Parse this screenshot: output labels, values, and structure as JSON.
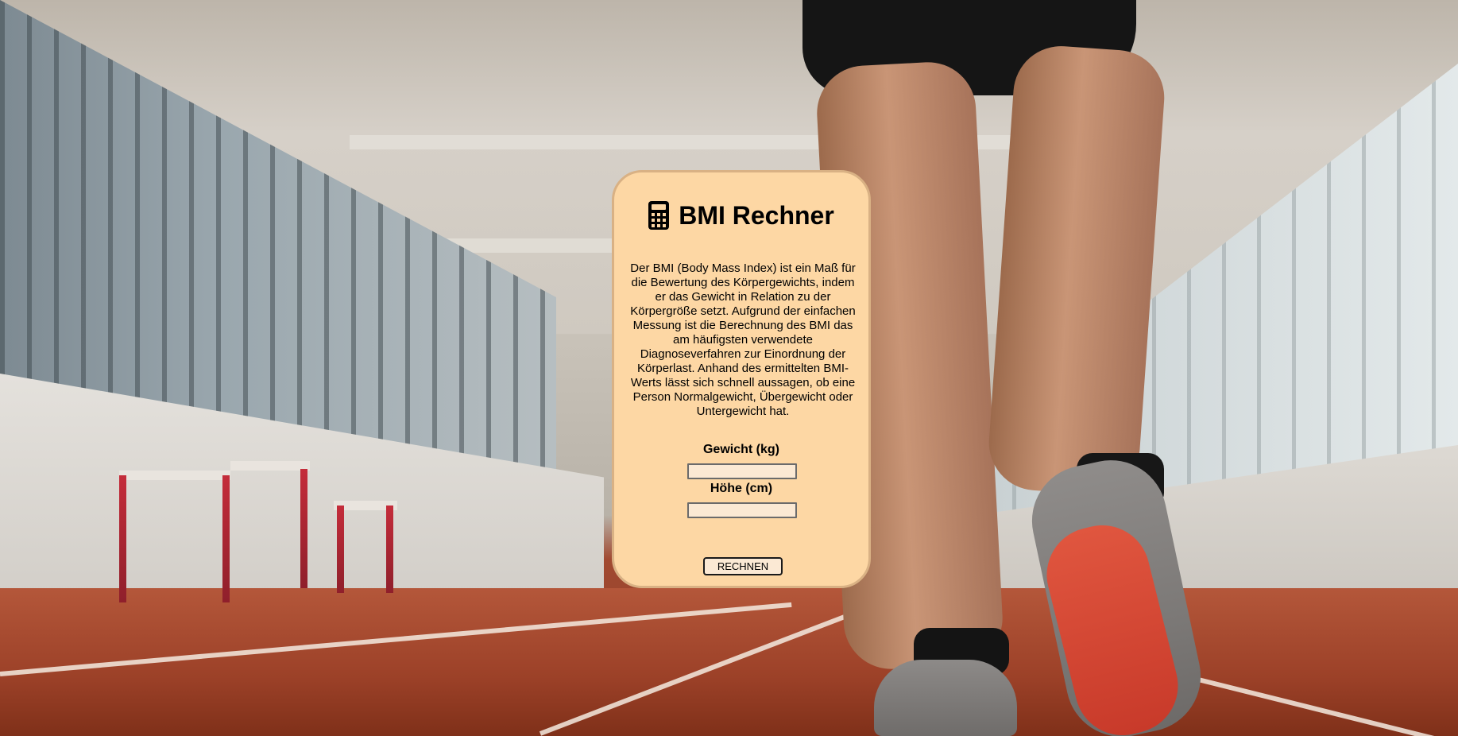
{
  "page": {
    "card_background": "#fdd7a4",
    "card_border": "#d9b184"
  },
  "card": {
    "icon": "calculator-icon",
    "title": "BMI Rechner",
    "description": "Der BMI (Body Mass Index) ist ein Maß für die Bewertung des Körpergewichts, indem er das Gewicht in Relation zu der Körpergröße setzt. Aufgrund der einfachen Messung ist die Berechnung des BMI das am häufigsten verwendete Diagnoseverfahren zur Einordnung der Körperlast. Anhand des ermittelten BMI-Werts lässt sich schnell aussagen, ob eine Person Normalgewicht, Übergewicht oder Untergewicht hat."
  },
  "form": {
    "weight_label": "Gewicht (kg)",
    "weight_value": "",
    "height_label": "Höhe (cm)",
    "height_value": "",
    "submit_label": "RECHNEN"
  }
}
